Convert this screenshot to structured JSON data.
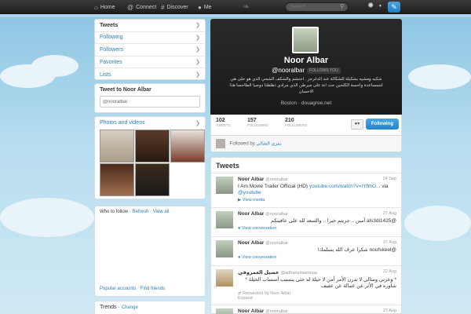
{
  "colors": {
    "accent": "#2a80b9",
    "topbar": "#1e1e1e",
    "button": "#2384c9"
  },
  "topbar": {
    "home": "Home",
    "connect": "Connect",
    "discover": "Discover",
    "me": "Me",
    "search_placeholder": "Search"
  },
  "leftnav": {
    "items": [
      "Tweets",
      "Following",
      "Followers",
      "Favorites",
      "Lists"
    ]
  },
  "tweet_to": {
    "title": "Tweet to Noor Albar",
    "value": "@nooralbar"
  },
  "photos": {
    "title": "Photos and videos"
  },
  "who_to_follow": {
    "title": "Who to follow",
    "refresh": "Refresh",
    "view_all": "View all",
    "popular": "Popular accounts",
    "find": "Find friends"
  },
  "trends": {
    "title": "Trends",
    "change": "Change"
  },
  "profile": {
    "name": "Noor Albar",
    "handle": "@nooralbar",
    "follows_you": "FOLLOWS YOU",
    "bio": "شكيه ومشيه بشكيلة للشكالة عند الدغرجز . اجتشم والشكف الشجي الدي هو حلى هي لتسساعدة واحسة الكلحين حث انة على ميرطن الذي مرادي ذهلطنا دوصيا الطاحسا هذا الاحسان",
    "location": "Boston · douagree.net"
  },
  "stats": [
    {
      "value": "102",
      "label": "TWEETS"
    },
    {
      "value": "157",
      "label": "FOLLOWING"
    },
    {
      "value": "210",
      "label": "FOLLOWERS"
    }
  ],
  "following_button": "Following",
  "followed_by": {
    "prefix": "Followed by",
    "name": "نمري الشالي"
  },
  "stream": {
    "title": "Tweets",
    "tweets": [
      {
        "name": "Noor Albar",
        "handle": "@nooralbar",
        "date": "24 Sep",
        "text": "I Am Movie Trailer Official (HD)",
        "link": "youtube.com/watch?v=IYfthO...",
        "via": "via",
        "via_link": "@youtube",
        "action": "View media"
      },
      {
        "name": "Noor Albar",
        "handle": "@nooralbar",
        "date": "27 Aug",
        "text": "@als3di1425 آمين .. جزيتم خيرا .. والسعد لله على عافيتكم",
        "action": "View conversation"
      },
      {
        "name": "Noor Albar",
        "handle": "@nooralbar",
        "date": "27 Aug",
        "text": "@noufskeel شكرا عرف الله يسلمك!",
        "action": "View conversation"
      },
      {
        "name": "عضيل الغمروفي",
        "handle": "@adhanalmamoaa",
        "date": "22 Aug",
        "text": "* وعرتي ومثالي لا تدرن الأمر أمن لا حيلة له حتى يتسبب أسساب الحيلة * شاوره في الأثر عن عمالة عن عفيف",
        "rt": "Retweeted by Noor Albar",
        "action": "Expand"
      },
      {
        "name": "Noor Albar",
        "handle": "@nooralbar",
        "date": "27 Aug",
        "text": ""
      }
    ]
  }
}
